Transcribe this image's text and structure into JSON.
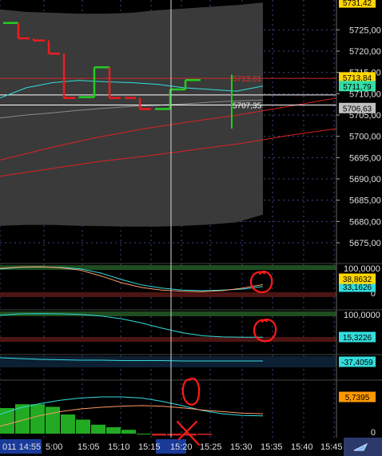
{
  "chart_data": [
    {
      "panel": "price",
      "type": "step-line",
      "ylim": [
        5672,
        5732
      ],
      "y_ticks": [
        "5725,00",
        "5720,00",
        "5715,00",
        "5710,00",
        "5705,00",
        "5700,00",
        "5695,00",
        "5690,00",
        "5685,00",
        "5680,00",
        "5675,00"
      ],
      "y_tick_values": [
        5725,
        5720,
        5715,
        5710,
        5705,
        5700,
        5695,
        5690,
        5685,
        5680,
        5675
      ],
      "price_tags": [
        {
          "label": "5731,42",
          "value": 5731.42,
          "bg": "#ffd700",
          "fg": "#000000"
        },
        {
          "label": "5713,84",
          "value": 5713.84,
          "bg": "#ffd700",
          "fg": "#000000"
        },
        {
          "label": "5711,79",
          "value": 5711.79,
          "bg": "#33dda6",
          "fg": "#000000"
        },
        {
          "label": "5706,63",
          "value": 5706.63,
          "bg": "#c0c0c0",
          "fg": "#000000"
        }
      ],
      "annotations": [
        {
          "label": "5713,61",
          "value": 5713.61,
          "color": "#e03030"
        },
        {
          "label": "5707,35",
          "value": 5707.35,
          "color": "#ffffff"
        }
      ],
      "steps": [
        {
          "t": 0,
          "y": 5726.6,
          "dir": "up"
        },
        {
          "t": 1,
          "y": 5723.0,
          "dir": "down"
        },
        {
          "t": 2,
          "y": 5722.5,
          "dir": "down"
        },
        {
          "t": 3,
          "y": 5719.4,
          "dir": "down"
        },
        {
          "t": 4,
          "y": 5709.0,
          "dir": "down"
        },
        {
          "t": 5,
          "y": 5709.2,
          "dir": "up"
        },
        {
          "t": 6,
          "y": 5716.2,
          "dir": "up"
        },
        {
          "t": 7,
          "y": 5709.0,
          "dir": "down"
        },
        {
          "t": 8,
          "y": 5709.0,
          "dir": "down"
        },
        {
          "t": 9,
          "y": 5706.4,
          "dir": "down"
        },
        {
          "t": 10,
          "y": 5706.4,
          "dir": "up"
        },
        {
          "t": 11,
          "y": 5711.0,
          "dir": "up"
        },
        {
          "t": 12,
          "y": 5713.2,
          "dir": "up"
        }
      ],
      "band_upper": [
        5729.8,
        5729.2,
        5729.0,
        5728.8,
        5728.8,
        5729.0,
        5729.6,
        5730.0,
        5730.4,
        5730.8,
        5731.4
      ],
      "band_lower": [
        5679.0,
        5679.2,
        5679.2,
        5679.0,
        5678.9,
        5678.8,
        5678.8,
        5679.0,
        5679.3,
        5679.8,
        5681.6
      ],
      "mid_line": [
        5704.3,
        5705.0,
        5705.5,
        5706.1,
        5706.6,
        5707.0,
        5707.3,
        5707.6,
        5708.0,
        5708.3,
        5708.5
      ],
      "cyan_line": [
        5709.0,
        5711.4,
        5712.6,
        5713.1,
        5712.8,
        5712.6,
        5712.2,
        5711.4,
        5711.0,
        5710.6,
        5711.8
      ],
      "red_line_a": [
        5694.4,
        5697.2,
        5699.7,
        5701.8,
        5703.5,
        5705.1,
        5707.0,
        5709.0
      ],
      "red_line_b": [
        5690.6,
        5692.3,
        5694.0,
        5695.3,
        5696.8,
        5698.3,
        5700.2,
        5701.8
      ],
      "hlines": [
        5713.61,
        5709.7,
        5707.35
      ]
    },
    {
      "panel": "oscillator-1",
      "type": "line",
      "ylim": [
        0,
        100
      ],
      "y_ticks": [
        "100,0000",
        "0"
      ],
      "tags": [
        {
          "label": "33,1626",
          "bg": "#33dddd",
          "fg": "#000000"
        },
        {
          "label": "38,8632",
          "bg": "#ffd700",
          "fg": "#000000"
        }
      ],
      "series": [
        {
          "name": "",
          "color": "#33dddd",
          "values": [
            88,
            93,
            94,
            93,
            88,
            75,
            55,
            38,
            28,
            22,
            20,
            22,
            25,
            33
          ]
        },
        {
          "name": "",
          "color": "#ff9966",
          "values": [
            90,
            94,
            95,
            92,
            84,
            66,
            45,
            30,
            22,
            18,
            17,
            20,
            28,
            39
          ]
        }
      ]
    },
    {
      "panel": "oscillator-2",
      "type": "line",
      "ylim": [
        0,
        100
      ],
      "y_ticks": [
        "100,0000",
        "0"
      ],
      "tags": [
        {
          "label": "15,3226",
          "bg": "#33dddd",
          "fg": "#000000"
        }
      ],
      "series": [
        {
          "name": "",
          "color": "#33dddd",
          "values": [
            88,
            92,
            93,
            92,
            90,
            85,
            76,
            62,
            45,
            30,
            20,
            16,
            15,
            15
          ]
        }
      ]
    },
    {
      "panel": "oscillator-3",
      "type": "line",
      "tags": [
        {
          "label": "-37,4059",
          "bg": "#33dddd",
          "fg": "#000000"
        }
      ],
      "series": [
        {
          "name": "",
          "color": "#33dddd",
          "values": [
            50,
            48,
            46,
            45,
            44,
            44,
            43,
            43,
            43,
            42,
            42,
            42,
            42,
            42
          ]
        }
      ]
    },
    {
      "panel": "oscillator-4",
      "type": "line+bar",
      "tags": [
        {
          "label": "5,7395",
          "bg": "#ff9900",
          "fg": "#000000"
        }
      ],
      "y_ticks": [
        "0"
      ],
      "series": [
        {
          "name": "",
          "color": "#33dddd",
          "values": [
            40,
            52,
            60,
            66,
            70,
            72,
            72,
            70,
            64,
            56,
            47,
            41,
            38,
            37
          ]
        },
        {
          "name": "",
          "color": "#ff9966",
          "values": [
            18,
            28,
            38,
            45,
            50,
            53,
            55,
            56,
            55,
            52,
            48,
            45,
            42,
            41
          ]
        }
      ],
      "bars": [
        {
          "value": 40,
          "color": "#22aa22"
        },
        {
          "value": 46,
          "color": "#22aa22"
        },
        {
          "value": 46,
          "color": "#22aa22"
        },
        {
          "value": 42,
          "color": "#22aa22"
        },
        {
          "value": 30,
          "color": "#22aa22"
        },
        {
          "value": 22,
          "color": "#22aa22"
        },
        {
          "value": 14,
          "color": "#22aa22"
        },
        {
          "value": 10,
          "color": "#22aa22"
        },
        {
          "value": 6,
          "color": "#22aa22"
        },
        {
          "value": 0,
          "color": "#22aa22"
        },
        {
          "value": -3,
          "color": "#cc2222"
        },
        {
          "value": -3,
          "color": "#cc2222"
        },
        {
          "value": -3,
          "color": "#cc2222"
        },
        {
          "value": -2,
          "color": "#cc2222"
        }
      ]
    }
  ],
  "time_axis": {
    "labels": [
      "011 14:55",
      "5:00",
      "15:05",
      "15:10",
      "15:15",
      "15:20",
      "15:25",
      "15:30",
      "15:35",
      "15:40",
      "15:45"
    ]
  },
  "crosshair_time": "15:20",
  "colors": {
    "background": "#000000",
    "band": "#3a3a3a",
    "step_up": "#22cc22",
    "step_down": "#ee1c1c",
    "cyan": "#33dddd",
    "orange": "#ff9966",
    "red_trend": "#dd2222",
    "panel_top_strip": "#1f4d1f",
    "panel_bottom_strip": "#4d1414",
    "grid": "#3c4a8a",
    "annotation_red": "#ff1a1a"
  }
}
